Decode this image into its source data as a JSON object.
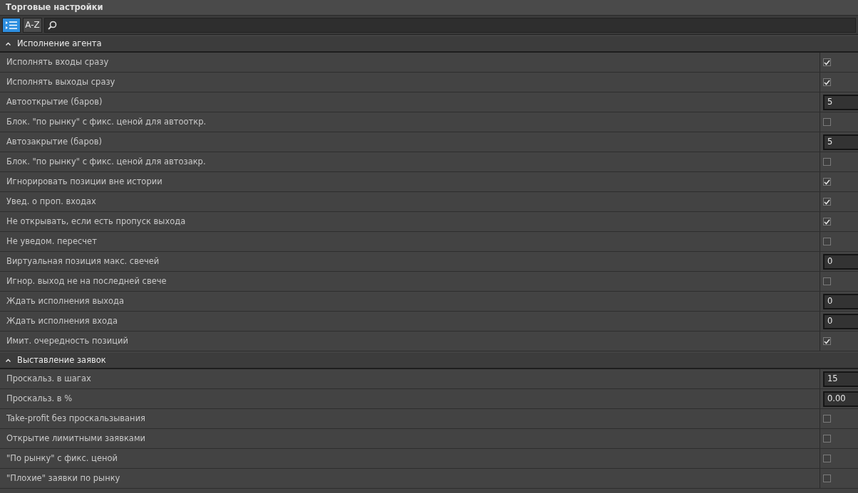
{
  "window": {
    "title": "Торговые настройки"
  },
  "toolbar": {
    "buttons": [
      {
        "kind": "category",
        "selected": true
      },
      {
        "kind": "alpha",
        "label": "A-Z",
        "selected": false
      }
    ]
  },
  "sections": [
    {
      "title": "Исполнение агента",
      "expanded": true,
      "rows": [
        {
          "label": "Исполнять входы сразу",
          "kind": "checkbox",
          "checked": true
        },
        {
          "label": "Исполнять выходы сразу",
          "kind": "checkbox",
          "checked": true
        },
        {
          "label": "Автооткрытие (баров)",
          "kind": "number",
          "value": "5"
        },
        {
          "label": "Блок. \"по рынку\" с фикс. ценой для автооткр.",
          "kind": "checkbox",
          "checked": false
        },
        {
          "label": "Автозакрытие (баров)",
          "kind": "number",
          "value": "5"
        },
        {
          "label": "Блок. \"по рынку\" с фикс. ценой для автозакр.",
          "kind": "checkbox",
          "checked": false
        },
        {
          "label": "Игнорировать позиции вне истории",
          "kind": "checkbox",
          "checked": true
        },
        {
          "label": "Увед. о проп. входах",
          "kind": "checkbox",
          "checked": true
        },
        {
          "label": "Не открывать, если есть пропуск выхода",
          "kind": "checkbox",
          "checked": true
        },
        {
          "label": "Не уведом. пересчет",
          "kind": "checkbox",
          "checked": false
        },
        {
          "label": "Виртуальная позиция макс. свечей",
          "kind": "number",
          "value": "0"
        },
        {
          "label": "Игнор. выход не на последней свече",
          "kind": "checkbox",
          "checked": false
        },
        {
          "label": "Ждать исполнения выхода",
          "kind": "number",
          "value": "0"
        },
        {
          "label": "Ждать исполнения входа",
          "kind": "number",
          "value": "0"
        },
        {
          "label": "Имит. очередность позиций",
          "kind": "checkbox",
          "checked": true
        }
      ]
    },
    {
      "title": "Выставление заявок",
      "expanded": true,
      "rows": [
        {
          "label": "Проскальз. в шагах",
          "kind": "number",
          "value": "15"
        },
        {
          "label": "Проскальз. в %",
          "kind": "number",
          "value": "0.00"
        },
        {
          "label": "Take-profit без проскальзывания",
          "kind": "checkbox",
          "checked": false
        },
        {
          "label": "Открытие лимитными заявками",
          "kind": "checkbox",
          "checked": false
        },
        {
          "label": "\"По рынку\" с фикс. ценой",
          "kind": "checkbox",
          "checked": false
        },
        {
          "label": "\"Плохие\" заявки по рынку",
          "kind": "checkbox",
          "checked": false
        }
      ]
    }
  ]
}
